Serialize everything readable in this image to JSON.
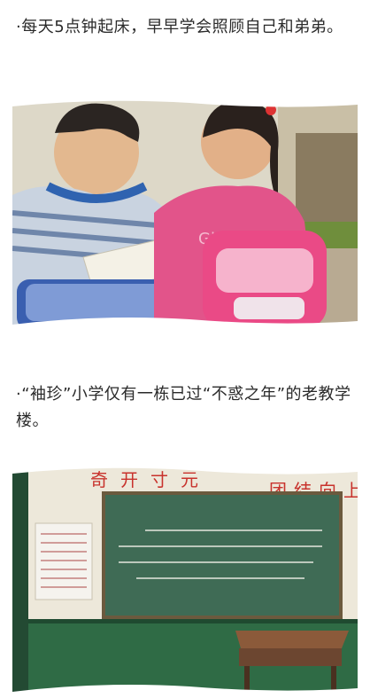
{
  "captions": {
    "first": "·每天5点钟起床，早早学会照顾自己和弟弟。",
    "second": "·“袖珍”小学仅有一栋已过“不惑之年”的老教学楼。"
  },
  "photo_top": {
    "description_icon": "photo-children-with-backpacks"
  },
  "photo_bottom": {
    "description_icon": "photo-old-classroom",
    "wall_slogan_left": "奇开寸元",
    "wall_slogan_right": "团结向上"
  },
  "colors": {
    "text": "#2a2a2a",
    "blackboard": "#3f6b55",
    "wall_green": "#2f6b45",
    "slogan_red": "#c8322c",
    "pink_jacket": "#e2548a"
  }
}
